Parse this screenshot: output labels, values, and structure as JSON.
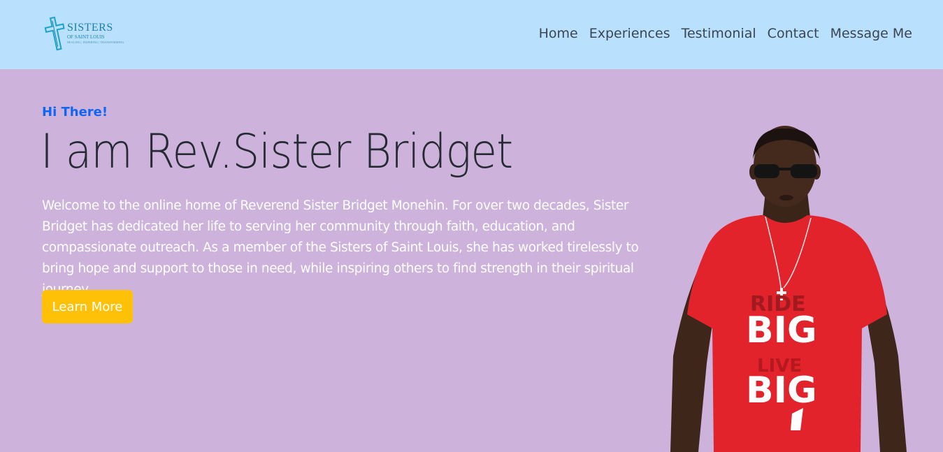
{
  "header": {
    "logo": {
      "icon": "cross-icon",
      "line1": "SISTERS",
      "line2": "OF SAINT LOUIS",
      "tagline": "HEALING | INSPIRING | TRANSFORMING"
    },
    "nav": [
      {
        "label": "Home"
      },
      {
        "label": "Experiences"
      },
      {
        "label": "Testimonial"
      },
      {
        "label": "Contact"
      },
      {
        "label": "Message Me"
      }
    ]
  },
  "hero": {
    "greeting": "Hi There!",
    "title": "I am Rev.Sister Bridget",
    "description": "Welcome to the online home of Reverend Sister Bridget Monehin. For over two decades, Sister Bridget has dedicated her life to serving her community through faith, education, and compassionate outreach. As a member of the Sisters of Saint Louis, she has worked tirelessly to bring hope and support to those in need, while inspiring others to find strength in their spiritual journey.",
    "cta_label": "Learn More",
    "photo": {
      "shirt_top": "RIDE",
      "shirt_word1": "BIG",
      "shirt_mid": "LIVE",
      "shirt_word2": "BIG"
    }
  },
  "colors": {
    "header_bg": "#b9e0fd",
    "page_bg": "#cdb2db",
    "accent_blue": "#1066f0",
    "button_bg": "#ffc107",
    "shirt_red": "#e2232b"
  }
}
